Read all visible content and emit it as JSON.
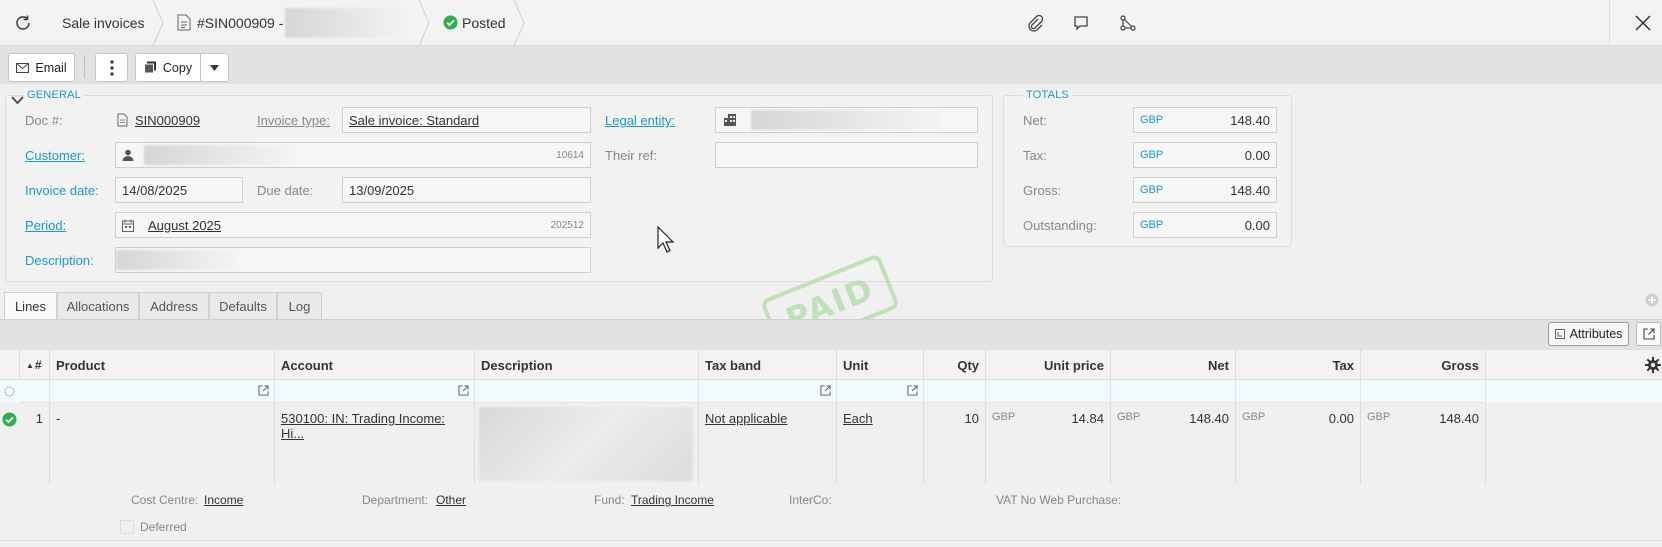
{
  "topbar": {
    "module": "Sale invoices",
    "doc_title": "#SIN000909 -",
    "status": "Posted",
    "status_color": "#2eae4e"
  },
  "toolbar": {
    "email_label": "Email",
    "copy_label": "Copy"
  },
  "general": {
    "legend": "GENERAL",
    "doc_label": "Doc #:",
    "doc_value": "SIN000909",
    "invoice_type_label": "Invoice type:",
    "invoice_type_value": "Sale invoice: Standard",
    "legal_entity_label": "Legal entity:",
    "customer_label": "Customer:",
    "customer_code": "10614",
    "their_ref_label": "Their ref:",
    "their_ref_value": "",
    "invoice_date_label": "Invoice date:",
    "invoice_date_value": "14/08/2025",
    "due_date_label": "Due date:",
    "due_date_value": "13/09/2025",
    "period_label": "Period:",
    "period_value": "August 2025",
    "period_code": "202512",
    "description_label": "Description:"
  },
  "totals": {
    "legend": "TOTALS",
    "rows": [
      {
        "label": "Net:",
        "currency": "GBP",
        "value": "148.40"
      },
      {
        "label": "Tax:",
        "currency": "GBP",
        "value": "0.00"
      },
      {
        "label": "Gross:",
        "currency": "GBP",
        "value": "148.40"
      },
      {
        "label": "Outstanding:",
        "currency": "GBP",
        "value": "0.00"
      }
    ]
  },
  "stamp": "PAID",
  "tabs": [
    "Lines",
    "Allocations",
    "Address",
    "Defaults",
    "Log"
  ],
  "grid": {
    "attributes_label": "Attributes",
    "columns": [
      "#",
      "Product",
      "Account",
      "Description",
      "Tax band",
      "Unit",
      "Qty",
      "Unit price",
      "Net",
      "Tax",
      "Gross"
    ],
    "row": {
      "num": "1",
      "product": "-",
      "account": "530100: IN: Trading Income: Hi...",
      "tax_band": "Not applicable",
      "unit": "Each",
      "qty": "10",
      "unit_price_cur": "GBP",
      "unit_price": "14.84",
      "net_cur": "GBP",
      "net": "148.40",
      "tax_cur": "GBP",
      "tax": "0.00",
      "gross_cur": "GBP",
      "gross": "148.40"
    },
    "details": {
      "cost_centre_label": "Cost Centre:",
      "cost_centre_value": "Income",
      "department_label": "Department:",
      "department_value": "Other",
      "fund_label": "Fund:",
      "fund_value": "Trading Income",
      "interco_label": "InterCo:",
      "vat_label": "VAT No Web Purchase:",
      "deferred_label": "Deferred"
    }
  }
}
